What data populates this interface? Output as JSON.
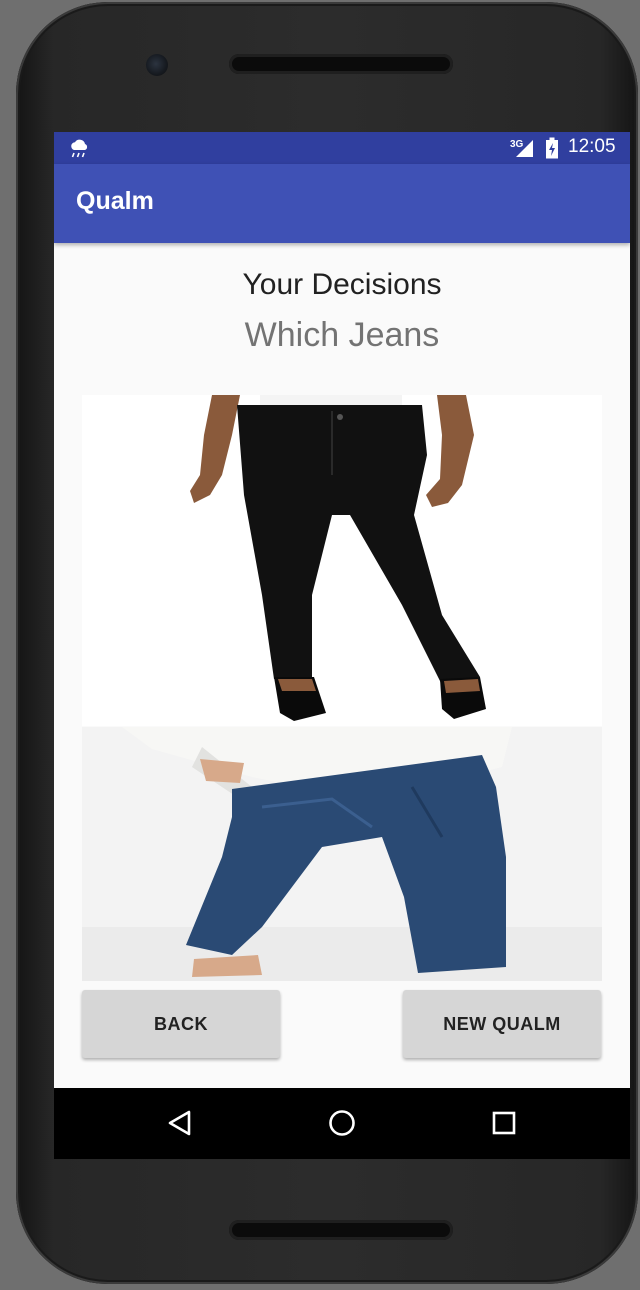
{
  "status_bar": {
    "time": "12:05",
    "network_label": "3G",
    "icons": [
      "weather-rain-icon",
      "cellular-signal-icon",
      "battery-charging-icon"
    ]
  },
  "app_bar": {
    "title": "Qualm"
  },
  "content": {
    "heading": "Your Decisions",
    "question": "Which Jeans",
    "images": [
      {
        "name": "black-jeans-image",
        "description_color": "#111111"
      },
      {
        "name": "blue-jeans-image",
        "description_color": "#2a4a74"
      }
    ]
  },
  "buttons": {
    "back_label": "BACK",
    "new_qualm_label": "NEW QUALM"
  },
  "nav_bar": {
    "icons": [
      "back-triangle-icon",
      "home-circle-icon",
      "recents-square-icon"
    ]
  },
  "colors": {
    "status_bar": "#303f9f",
    "app_bar": "#3f51b5",
    "button": "#d6d6d6"
  }
}
